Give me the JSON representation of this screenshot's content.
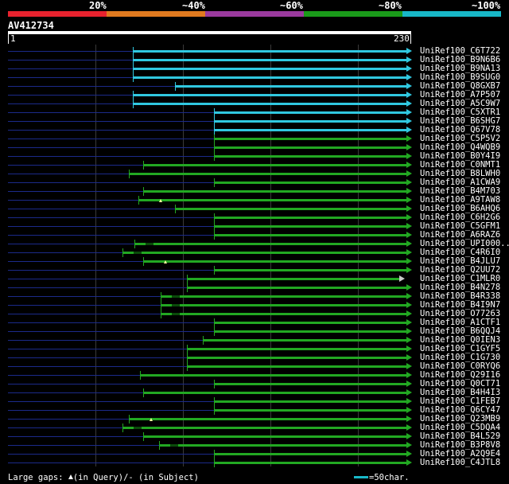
{
  "colors": {
    "band_red": "#e8222e",
    "band_orange": "#e07a1f",
    "band_purple": "#9a3a9e",
    "band_green": "#1a9a1a",
    "band_cyan": "#18b8c8",
    "hit_cyan": "#30c8e0",
    "hit_green": "#22a822",
    "leader": "#1b2a8a"
  },
  "percent_labels": {
    "p20": "20%",
    "p40": "~40%",
    "p60": "~60%",
    "p80": "~80%",
    "p100": "~100%"
  },
  "query": {
    "id": "AV412734",
    "start": "1",
    "end": "230"
  },
  "legend": {
    "gaps_prefix": "Large gaps: ",
    "gaps_query": "(in Query)/",
    "gaps_subject": "- (in Subject)",
    "scale": "=50char."
  },
  "chart_data": {
    "type": "alignment-overview",
    "query_length": 230,
    "hits": [
      {
        "name": "UniRef100_C6T722",
        "start": 72,
        "color": "cyan"
      },
      {
        "name": "UniRef100_B9N6B6",
        "start": 72,
        "color": "cyan"
      },
      {
        "name": "UniRef100_B9NA13",
        "start": 72,
        "color": "cyan"
      },
      {
        "name": "UniRef100_B9SUG0",
        "start": 72,
        "color": "cyan"
      },
      {
        "name": "UniRef100_Q8GXB7",
        "start": 96,
        "color": "cyan"
      },
      {
        "name": "UniRef100_A7P507",
        "start": 72,
        "color": "cyan"
      },
      {
        "name": "UniRef100_A5C9W7",
        "start": 72,
        "color": "cyan"
      },
      {
        "name": "UniRef100_C5XTR1",
        "start": 118,
        "color": "cyan"
      },
      {
        "name": "UniRef100_B6SHG7",
        "start": 118,
        "color": "cyan"
      },
      {
        "name": "UniRef100_Q67V78",
        "start": 118,
        "color": "cyan"
      },
      {
        "name": "UniRef100_C5P5V2",
        "start": 118,
        "color": "green"
      },
      {
        "name": "UniRef100_Q4WQB9",
        "start": 118,
        "color": "green"
      },
      {
        "name": "UniRef100_B0Y4I9",
        "start": 118,
        "color": "green"
      },
      {
        "name": "UniRef100_C0NMT1",
        "start": 78,
        "color": "green"
      },
      {
        "name": "UniRef100_B8LWH0",
        "start": 70,
        "color": "green"
      },
      {
        "name": "UniRef100_A1CWA9",
        "start": 118,
        "color": "green"
      },
      {
        "name": "UniRef100_B4M703",
        "start": 78,
        "color": "green"
      },
      {
        "name": "UniRef100_A9TAW8",
        "start": 75,
        "color": "green",
        "query_gap": true
      },
      {
        "name": "UniRef100_B6AHQ6",
        "start": 96,
        "color": "green"
      },
      {
        "name": "UniRef100_C6H2G6",
        "start": 118,
        "color": "green"
      },
      {
        "name": "UniRef100_C5GFM1",
        "start": 118,
        "color": "green"
      },
      {
        "name": "UniRef100_A6RAZ6",
        "start": 118,
        "color": "green"
      },
      {
        "name": "UniRef100_UPI000...",
        "start": 73,
        "color": "green",
        "subject_gap": true
      },
      {
        "name": "UniRef100_C4R6I0",
        "start": 66,
        "color": "green",
        "subject_gap": true
      },
      {
        "name": "UniRef100_B4JLU7",
        "start": 78,
        "color": "green",
        "query_gap": true
      },
      {
        "name": "UniRef100_Q2UU72",
        "start": 118,
        "color": "green"
      },
      {
        "name": "UniRef100_C1MLR0",
        "start": 103,
        "color": "green",
        "end": 226,
        "open_arrow": true
      },
      {
        "name": "UniRef100_B4N278",
        "start": 103,
        "color": "green"
      },
      {
        "name": "UniRef100_B4R338",
        "start": 88,
        "color": "green",
        "subject_gap": true
      },
      {
        "name": "UniRef100_B4I9N7",
        "start": 88,
        "color": "green",
        "subject_gap": true
      },
      {
        "name": "UniRef100_O77263",
        "start": 88,
        "color": "green",
        "subject_gap": true
      },
      {
        "name": "UniRef100_A1CTF1",
        "start": 118,
        "color": "green"
      },
      {
        "name": "UniRef100_B6QQJ4",
        "start": 118,
        "color": "green"
      },
      {
        "name": "UniRef100_Q0IEN3",
        "start": 112,
        "color": "green"
      },
      {
        "name": "UniRef100_C1GYF5",
        "start": 103,
        "color": "green"
      },
      {
        "name": "UniRef100_C1G730",
        "start": 103,
        "color": "green"
      },
      {
        "name": "UniRef100_C0RYQ6",
        "start": 103,
        "color": "green"
      },
      {
        "name": "UniRef100_Q29I16",
        "start": 76,
        "color": "green"
      },
      {
        "name": "UniRef100_Q0CT71",
        "start": 118,
        "color": "green"
      },
      {
        "name": "UniRef100_B4H4I3",
        "start": 78,
        "color": "green"
      },
      {
        "name": "UniRef100_C1FEB7",
        "start": 118,
        "color": "green"
      },
      {
        "name": "UniRef100_Q6CY47",
        "start": 118,
        "color": "green"
      },
      {
        "name": "UniRef100_Q23MB9",
        "start": 70,
        "color": "green",
        "query_gap": true
      },
      {
        "name": "UniRef100_C5DQA4",
        "start": 66,
        "color": "green",
        "subject_gap": true
      },
      {
        "name": "UniRef100_B4L529",
        "start": 78,
        "color": "green"
      },
      {
        "name": "UniRef100_B3P8V8",
        "start": 87,
        "color": "green",
        "subject_gap": true
      },
      {
        "name": "UniRef100_A2Q9E4",
        "start": 118,
        "color": "green"
      },
      {
        "name": "UniRef100_C4JTL8",
        "start": 118,
        "color": "green"
      }
    ]
  }
}
